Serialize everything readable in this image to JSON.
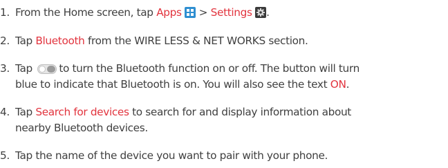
{
  "accent_color": "#e2343e",
  "icons": {
    "apps": "apps-grid-icon",
    "settings": "settings-gear-icon",
    "toggle": "bluetooth-toggle-switch-icon"
  },
  "steps": [
    {
      "number": "1.",
      "pre": "From the Home screen, tap ",
      "link1": "Apps",
      "sep": " > ",
      "link2": "Settings",
      "post": "."
    },
    {
      "number": "2.",
      "pre": "Tap ",
      "link": "Bluetooth",
      "post": " from the WIRE LESS & NET WORKS section."
    },
    {
      "number": "3.",
      "pre": "Tap ",
      "line1_post": "to turn the Bluetooth function on or off. The button will turn",
      "line2_pre": "blue to indicate that Bluetooth is on. You will also see the text ",
      "link": "ON",
      "line2_post": "."
    },
    {
      "number": "4.",
      "pre": "Tap ",
      "link": "Search for devices",
      "line1_post": " to search for and display information about",
      "line2": "nearby Bluetooth devices."
    },
    {
      "number": "5.",
      "text": "Tap the name of the device you want to pair with your phone."
    }
  ]
}
